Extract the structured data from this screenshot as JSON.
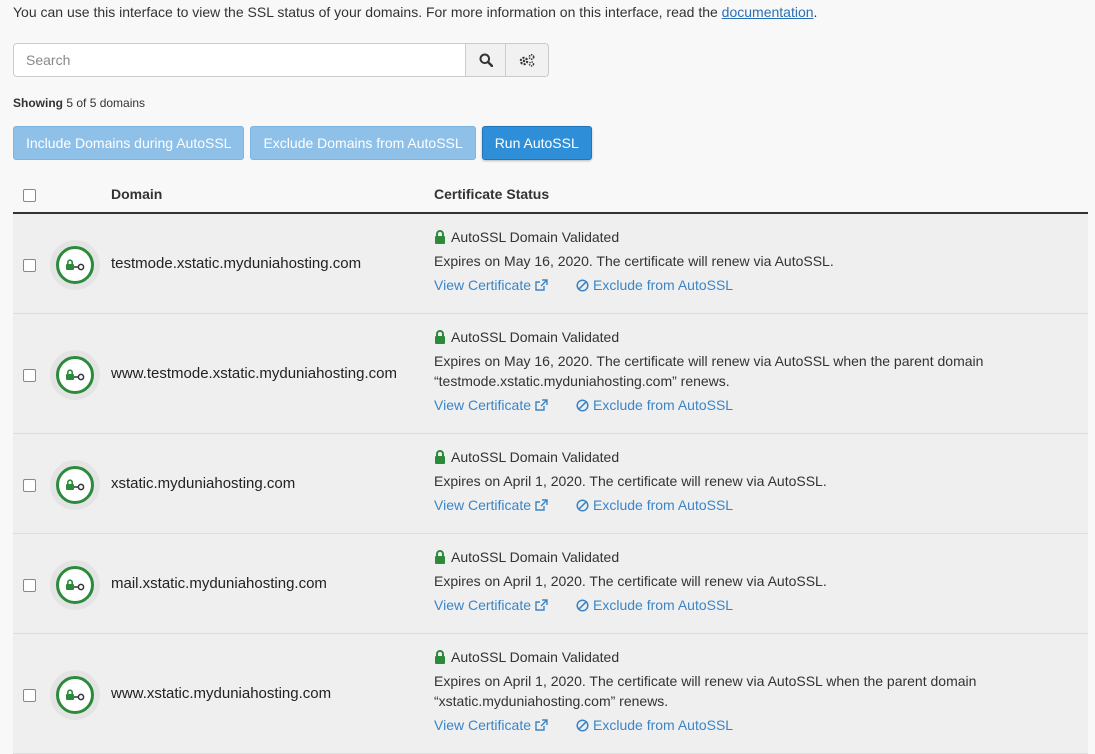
{
  "intro": {
    "text": "You can use this interface to view the SSL status of your domains. For more information on this interface, read the ",
    "link": "documentation",
    "suffix": "."
  },
  "search": {
    "placeholder": "Search"
  },
  "showing": {
    "label": "Showing",
    "count": "5 of 5 domains"
  },
  "actions": {
    "include": "Include Domains during AutoSSL",
    "exclude": "Exclude Domains from AutoSSL",
    "run": "Run AutoSSL"
  },
  "table": {
    "col_domain": "Domain",
    "col_status": "Certificate Status",
    "rows": [
      {
        "domain": "testmode.xstatic.myduniahosting.com",
        "status": "AutoSSL Domain Validated",
        "detail": "Expires on May 16, 2020. The certificate will renew via AutoSSL.",
        "view": "View Certificate",
        "exclude": "Exclude from AutoSSL"
      },
      {
        "domain": "www.testmode.xstatic.myduniahosting.com",
        "status": "AutoSSL Domain Validated",
        "detail": "Expires on May 16, 2020. The certificate will renew via AutoSSL when the parent domain “testmode.xstatic.myduniahosting.com” renews.",
        "view": "View Certificate",
        "exclude": "Exclude from AutoSSL"
      },
      {
        "domain": "xstatic.myduniahosting.com",
        "status": "AutoSSL Domain Validated",
        "detail": "Expires on April 1, 2020. The certificate will renew via AutoSSL.",
        "view": "View Certificate",
        "exclude": "Exclude from AutoSSL"
      },
      {
        "domain": "mail.xstatic.myduniahosting.com",
        "status": "AutoSSL Domain Validated",
        "detail": "Expires on April 1, 2020. The certificate will renew via AutoSSL.",
        "view": "View Certificate",
        "exclude": "Exclude from AutoSSL"
      },
      {
        "domain": "www.xstatic.myduniahosting.com",
        "status": "AutoSSL Domain Validated",
        "detail": "Expires on April 1, 2020. The certificate will renew via AutoSSL when the parent domain “xstatic.myduniahosting.com” renews.",
        "view": "View Certificate",
        "exclude": "Exclude from AutoSSL"
      }
    ]
  },
  "colors": {
    "link": "#3a85c6",
    "success": "#2c8a3b",
    "primary": "#2e8fd8",
    "primary_light": "#8ec0e8"
  },
  "icons": [
    "search-icon",
    "settings-gears-icon",
    "lock-icon",
    "ssl-key-icon",
    "external-link-icon",
    "ban-icon"
  ]
}
